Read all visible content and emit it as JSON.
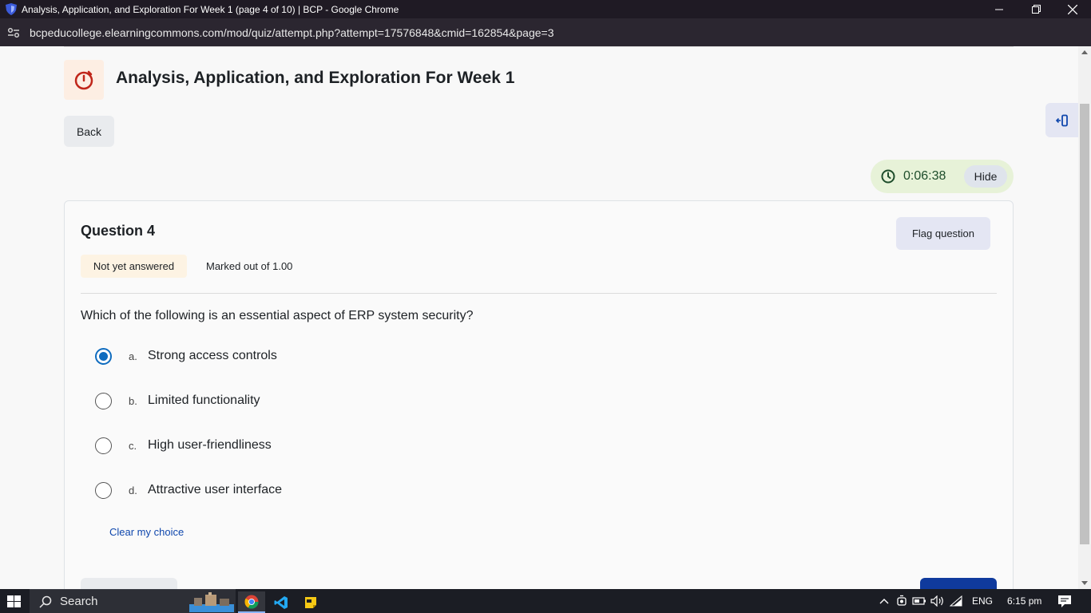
{
  "browser": {
    "window_title": "Analysis, Application, and Exploration For Week 1 (page 4 of 10) | BCP - Google Chrome",
    "url": "bcpeducollege.elearningcommons.com/mod/quiz/attempt.php?attempt=17576848&cmid=162854&page=3"
  },
  "page": {
    "title": "Analysis, Application, and Exploration For Week 1",
    "back_label": "Back"
  },
  "timer": {
    "value": "0:06:38",
    "hide_label": "Hide"
  },
  "question": {
    "number_label": "Question 4",
    "state": "Not yet answered",
    "marks": "Marked out of 1.00",
    "flag_label": "Flag question",
    "text": "Which of the following is an essential aspect of ERP system security?",
    "options": [
      {
        "letter": "a.",
        "text": "Strong access controls",
        "selected": true
      },
      {
        "letter": "b.",
        "text": "Limited functionality",
        "selected": false
      },
      {
        "letter": "c.",
        "text": "High user-friendliness",
        "selected": false
      },
      {
        "letter": "d.",
        "text": "Attractive user interface",
        "selected": false
      }
    ],
    "clear_label": "Clear my choice"
  },
  "taskbar": {
    "search_placeholder": "Search",
    "language": "ENG",
    "time": "6:15 pm"
  },
  "colors": {
    "accent": "#0f6cbf",
    "title_bar": "#1f1a24",
    "timer_bg": "#e7f2d8",
    "next_button": "#0f3a9d"
  }
}
